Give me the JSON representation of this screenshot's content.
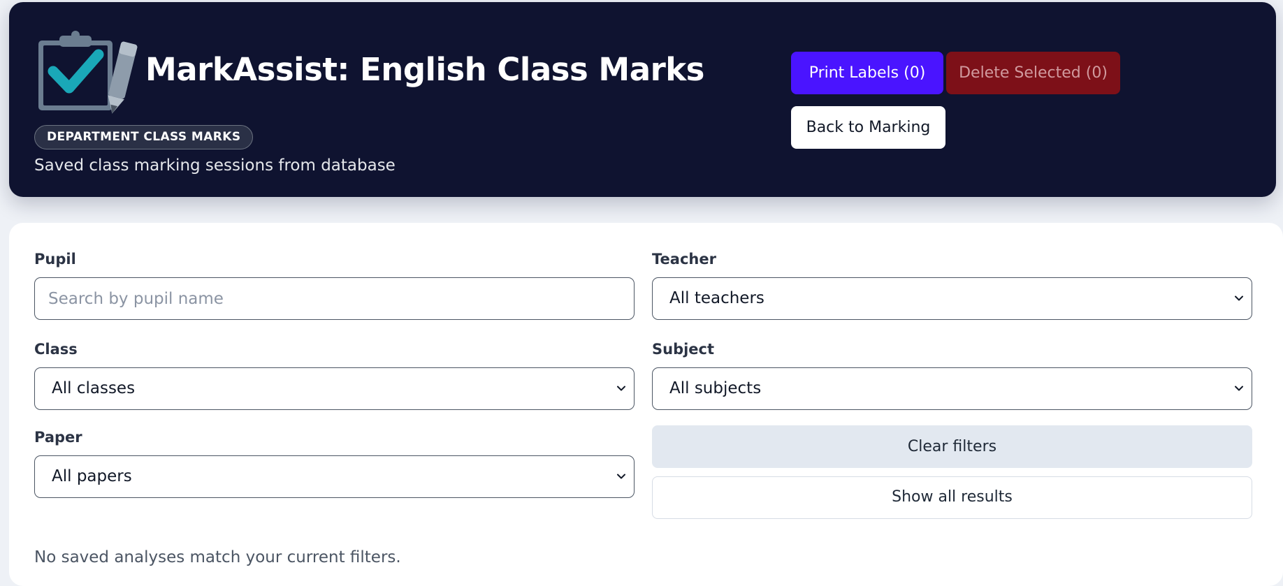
{
  "header": {
    "title": "MarkAssist: English Class Marks",
    "badge": "DEPARTMENT CLASS MARKS",
    "subtitle": "Saved class marking sessions from database",
    "logo_icon": "clipboard-check-pen-icon",
    "colors": {
      "background": "#0f1330",
      "print": "#4a14ff",
      "delete": "#7d1018",
      "check": "#1aa8b8"
    },
    "actions": {
      "print_label": "Print Labels (0)",
      "delete_label": "Delete Selected (0)",
      "back_label": "Back to Marking"
    }
  },
  "filters": {
    "pupil": {
      "label": "Pupil",
      "placeholder": "Search by pupil name",
      "value": ""
    },
    "teacher": {
      "label": "Teacher",
      "value": "All teachers"
    },
    "class": {
      "label": "Class",
      "value": "All classes"
    },
    "subject": {
      "label": "Subject",
      "value": "All subjects"
    },
    "paper": {
      "label": "Paper",
      "value": "All papers"
    },
    "clear_label": "Clear filters",
    "show_all_label": "Show all results"
  },
  "results": {
    "empty_message": "No saved analyses match your current filters."
  }
}
